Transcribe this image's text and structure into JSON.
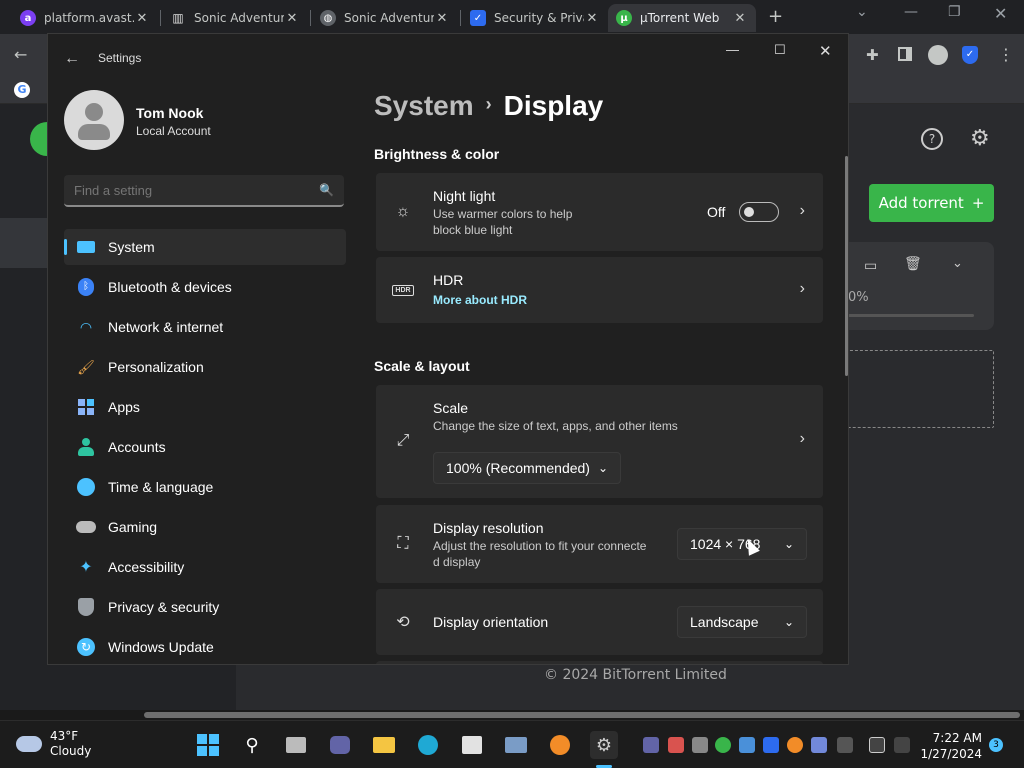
{
  "browser": {
    "tabs": [
      {
        "title": "platform.avast.com",
        "favicon": "avast-icon",
        "color": "#7b3ff2"
      },
      {
        "title": "Sonic Adventure",
        "favicon": "museum-icon",
        "color": "#444444"
      },
      {
        "title": "Sonic Adventure",
        "favicon": "globe-icon",
        "color": "#5f6368"
      },
      {
        "title": "Security & Privacy",
        "favicon": "shield-check-icon",
        "color": "#2d6bef"
      },
      {
        "title": "µTorrent Web",
        "favicon": "utorrent-icon",
        "color": "#39b54a"
      }
    ],
    "bookmark_initial": "G"
  },
  "utorrent": {
    "add_torrent_label": "Add torrent",
    "progress": "0%",
    "copyright": "© 2024 BitTorrent Limited",
    "accent": "#39b54a"
  },
  "settings": {
    "window_title": "Settings",
    "user": {
      "name": "Tom Nook",
      "account_type": "Local Account"
    },
    "search_placeholder": "Find a setting",
    "nav": [
      {
        "label": "System",
        "icon": "monitor-icon",
        "active": true
      },
      {
        "label": "Bluetooth & devices",
        "icon": "bluetooth-icon"
      },
      {
        "label": "Network & internet",
        "icon": "wifi-icon"
      },
      {
        "label": "Personalization",
        "icon": "brush-icon"
      },
      {
        "label": "Apps",
        "icon": "apps-icon"
      },
      {
        "label": "Accounts",
        "icon": "person-icon"
      },
      {
        "label": "Time & language",
        "icon": "globe-clock-icon"
      },
      {
        "label": "Gaming",
        "icon": "gamepad-icon"
      },
      {
        "label": "Accessibility",
        "icon": "accessibility-icon"
      },
      {
        "label": "Privacy & security",
        "icon": "shield-icon"
      },
      {
        "label": "Windows Update",
        "icon": "update-icon"
      }
    ],
    "breadcrumb": {
      "parent": "System",
      "current": "Display"
    },
    "sections": {
      "brightness": "Brightness & color",
      "scale_layout": "Scale & layout"
    },
    "night_light": {
      "title": "Night light",
      "subtitle_line1": "Use warmer colors to help",
      "subtitle_line2": "block blue light",
      "state": "Off"
    },
    "hdr": {
      "title": "HDR",
      "link": "More about HDR"
    },
    "scale": {
      "title": "Scale",
      "subtitle": "Change the size of text, apps, and other items",
      "value": "100% (Recommended)"
    },
    "resolution": {
      "title": "Display resolution",
      "subtitle_line1": "Adjust the resolution to fit your connecte",
      "subtitle_line2": "d display",
      "value": "1024 × 768"
    },
    "orientation": {
      "title": "Display orientation",
      "value": "Landscape"
    },
    "accent": "#4cc2ff"
  },
  "taskbar": {
    "weather": {
      "temp": "43°F",
      "condition": "Cloudy"
    },
    "time": "7:22 AM",
    "date": "1/27/2024",
    "notifications": "3"
  }
}
